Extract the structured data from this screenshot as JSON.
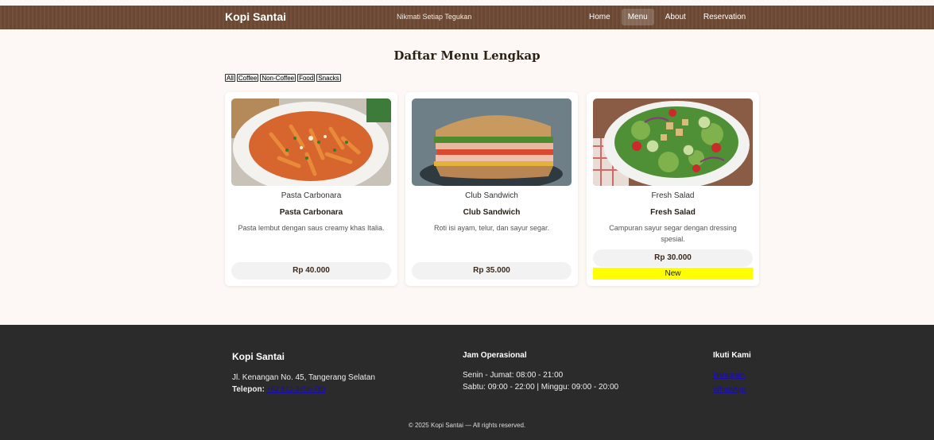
{
  "header": {
    "brand": "Kopi Santai",
    "tagline": "Nikmati Setiap Tegukan",
    "nav": [
      {
        "label": "Home",
        "active": false
      },
      {
        "label": "Menu",
        "active": true
      },
      {
        "label": "About",
        "active": false
      },
      {
        "label": "Reservation",
        "active": false
      }
    ]
  },
  "main": {
    "title": "Daftar Menu Lengkap",
    "filters": [
      "All",
      "Coffee",
      "Non-Coffee",
      "Food",
      "Snacks"
    ],
    "items": [
      {
        "image_alt": "Pasta Carbonara",
        "name": "Pasta Carbonara",
        "description": "Pasta lembut dengan saus creamy khas Italia.",
        "price": "Rp 40.000"
      },
      {
        "image_alt": "Club Sandwich",
        "name": "Club Sandwich",
        "description": "Roti isi ayam, telur, dan sayur segar.",
        "price": "Rp 35.000"
      },
      {
        "image_alt": "Fresh Salad",
        "name": "Fresh Salad",
        "description": "Campuran sayur segar dengan dressing spesial.",
        "price": "Rp 30.000",
        "badge": "New"
      }
    ]
  },
  "footer": {
    "about": {
      "title": "Kopi Santai",
      "address": "Jl. Kenangan No. 45, Tangerang Selatan",
      "phone_label": "Telepon:",
      "phone": "+62 812-3456-789"
    },
    "hours": {
      "title": "Jam Operasional",
      "weekday": "Senin - Jumat: 08:00 - 21:00",
      "weekend": "Sabtu: 09:00 - 22:00 | Minggu: 09:00 - 20:00"
    },
    "social": {
      "title": "Ikuti Kami",
      "links": [
        "Instagram",
        "WhatsApp"
      ]
    },
    "copyright": "© 2025 Kopi Santai — All rights reserved."
  },
  "colors": {
    "header_bg": "#6e4a36",
    "footer_bg": "#2b2b2b",
    "badge_bg": "#ffff00"
  }
}
